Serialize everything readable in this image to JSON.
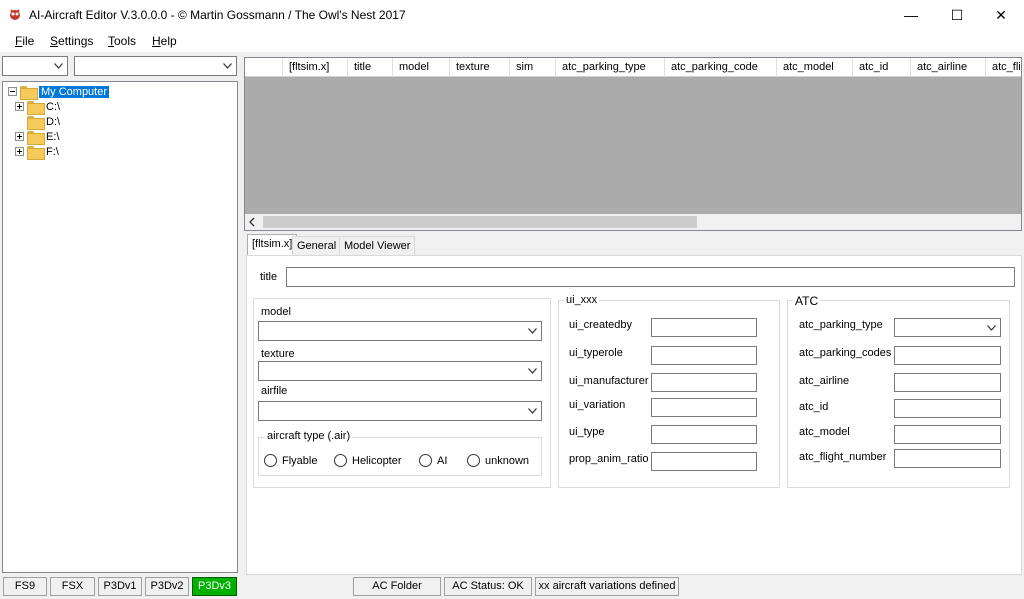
{
  "window": {
    "title": "AI-Aircraft Editor V.3.0.0.0  -  © Martin Gossmann / The Owl's Nest 2017",
    "minimize_glyph": "—",
    "maximize_glyph": "☐",
    "close_glyph": "✕"
  },
  "menu": [
    {
      "label": "File",
      "accel": "F",
      "rest": "ile"
    },
    {
      "label": "Settings",
      "accel": "S",
      "rest": "ettings"
    },
    {
      "label": "Tools",
      "accel": "T",
      "rest": "ools"
    },
    {
      "label": "Help",
      "accel": "H",
      "rest": "elp"
    }
  ],
  "filters": {
    "combo1_value": "",
    "combo2_value": ""
  },
  "tree": {
    "root": "My Computer",
    "drives": [
      "C:\\",
      "D:\\",
      "E:\\",
      "F:\\"
    ]
  },
  "grid": {
    "columns": [
      "[fltsim.x]",
      "title",
      "model",
      "texture",
      "sim",
      "atc_parking_type",
      "atc_parking_code",
      "atc_model",
      "atc_id",
      "atc_airline",
      "atc_flig"
    ],
    "rows": []
  },
  "tabs": [
    "[fltsim.x]",
    "General",
    "Model Viewer"
  ],
  "form": {
    "title_label": "title",
    "title_value": "",
    "model_label": "model",
    "texture_label": "texture",
    "airfile_label": "airfile",
    "aircraft_type_caption": "aircraft type (.air)",
    "aircraft_types": [
      "Flyable",
      "Helicopter",
      "AI",
      "unknown"
    ],
    "ui_caption": "ui_xxx",
    "ui_fields": [
      "ui_createdby",
      "ui_typerole",
      "ui_manufacturer",
      "ui_variation",
      "ui_type",
      "prop_anim_ratio"
    ],
    "atc_caption": "ATC",
    "atc_fields": [
      "atc_parking_type",
      "atc_parking_codes",
      "atc_airline",
      "atc_id",
      "atc_model",
      "atc_flight_number"
    ]
  },
  "status": {
    "sims": [
      "FS9",
      "FSX",
      "P3Dv1",
      "P3Dv2",
      "P3Dv3"
    ],
    "active_sim": "P3Dv3",
    "ac_folder": "AC Folder",
    "ac_status": "AC Status: OK",
    "variations": "xx aircraft variations defined"
  },
  "colors": {
    "active_sim_bg": "#00b000",
    "selection": "#0078d7",
    "grid_bg": "#ababab"
  },
  "icons": {
    "app": "owl-icon",
    "expand": "plus-box-icon",
    "folder": "folder-icon",
    "dropdown": "chevron-down-icon"
  }
}
